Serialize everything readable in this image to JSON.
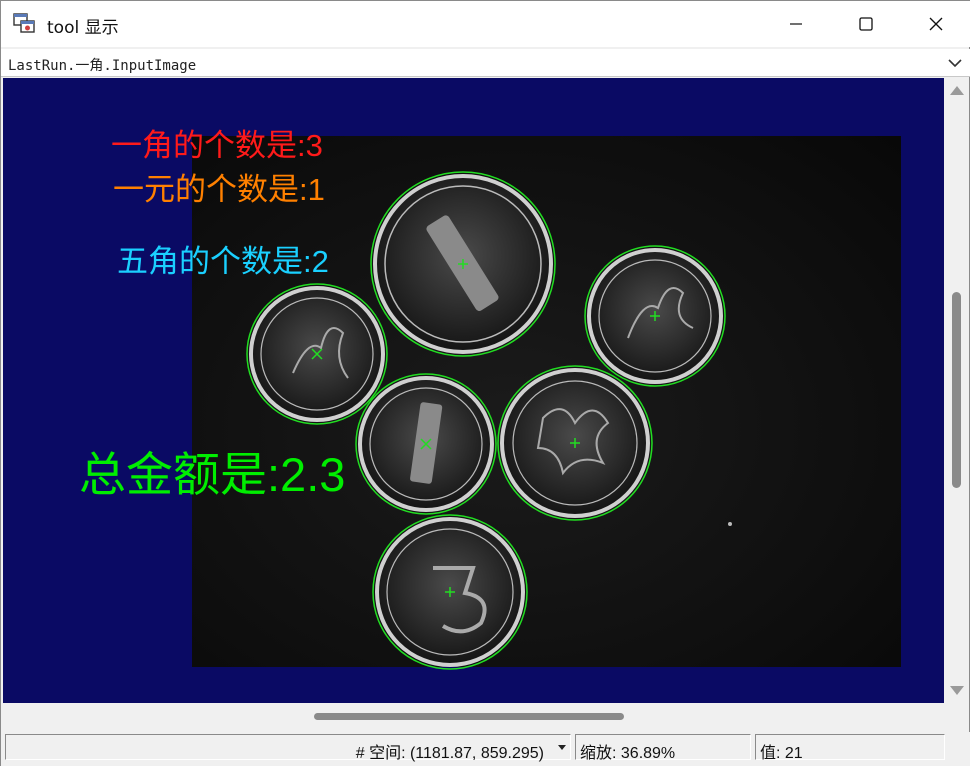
{
  "window": {
    "title": "tool 显示",
    "icon": "display-window-icon",
    "controls": [
      "minimize-icon",
      "maximize-icon",
      "close-icon"
    ]
  },
  "image_selector": {
    "value": "LastRun.一角.InputImage"
  },
  "overlay": {
    "jiao_count_label": "一角的个数是:3",
    "yuan_count_label": "一元的个数是:1",
    "wujiao_count_label": "五角的个数是:2",
    "total_label": "总金额是:2.3"
  },
  "colors": {
    "viewport_bg": "#0a0a64",
    "jiao_text": "#ff1a1a",
    "yuan_text": "#ff8000",
    "wujiao_text": "#1ad0ff",
    "total_text": "#00ee00",
    "detection_circle": "#22dd22"
  },
  "statusbar": {
    "coord_text": "# 空间:  (1181.87, 859.295)",
    "zoom_text": "缩放:   36.89%",
    "value_text": "值:   21"
  }
}
